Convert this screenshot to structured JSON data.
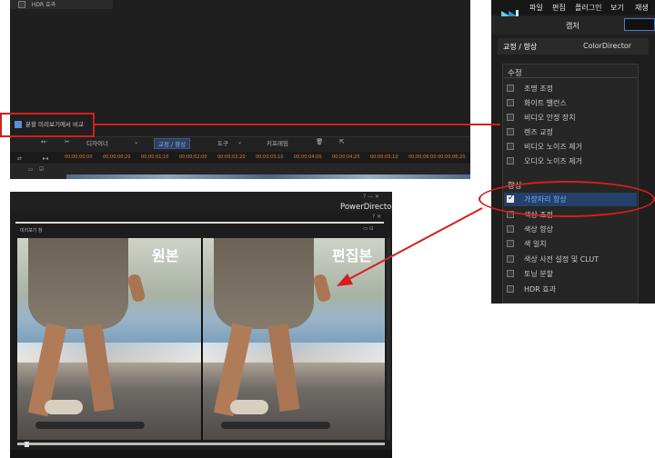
{
  "editor": {
    "hdr_item": "HDR 효과",
    "split_compare_label": "분할 미리보기에서 비교",
    "toolbar": {
      "designer": "디자이너",
      "correction": "교정 / 향상",
      "tools": "도구",
      "keyframe": "키프레임"
    },
    "ruler_ticks": [
      "00;00;00;00",
      "00;00;00;20",
      "00;00;01;10",
      "00;00;02;00",
      "00;00;02;20",
      "00;00;03;10",
      "00;00;04;00",
      "00;00;04;20",
      "00;00;05;10",
      "00;00;06;00",
      "00;00;06;20"
    ]
  },
  "settings": {
    "menu": [
      "파일",
      "편집",
      "플러그인",
      "보기",
      "재생"
    ],
    "capture": "캡처",
    "tabs": [
      "교정 / 향상",
      "ColorDirector"
    ],
    "correction_section": "수정",
    "correction_items": [
      "조명 조정",
      "화이트 밸런스",
      "비디오 안정 장치",
      "렌즈 교정",
      "비디오 노이즈 제거",
      "오디오 노이즈 제거"
    ],
    "enhance_section": "향상",
    "enhance_items": [
      "가장자리 향상",
      "색상 조정",
      "색상 향상",
      "색 일치",
      "색상 사전 설정 및 CLUT",
      "토닝 분할",
      "HDR 효과"
    ],
    "selected_item": "가장자리 향상"
  },
  "preview": {
    "app_name": "PowerDirector",
    "window_title": "미리보기 창",
    "left_label": "원본",
    "right_label": "편집본",
    "win_controls": "? —  ✕",
    "sub_controls": "? ✕"
  },
  "colors": {
    "highlight": "#d61e1e",
    "accent": "#4a7cc9",
    "panel_bg": "#1e1e1e"
  }
}
